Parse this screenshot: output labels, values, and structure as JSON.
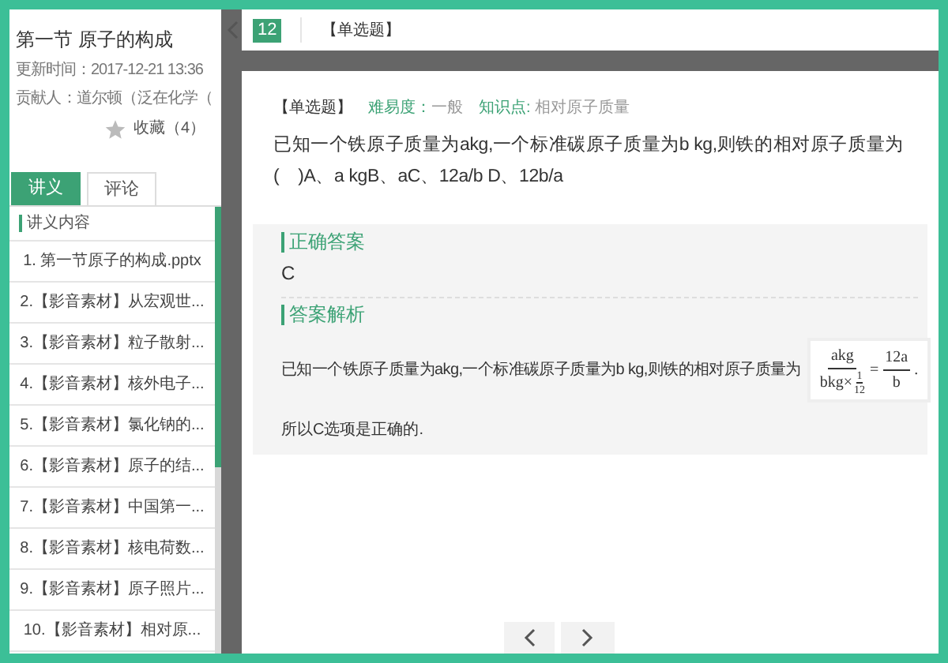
{
  "sidebar": {
    "title": "第一节 原子的构成",
    "updated": "更新时间：2017-12-21 13:36",
    "contributor": "贡献人：道尔顿（泛在化学（",
    "favorite": {
      "label": "收藏（4）",
      "selected": false
    },
    "tabs": [
      {
        "label": "讲义",
        "selected": true
      },
      {
        "label": "评论",
        "selected": false
      }
    ],
    "list_heading": "讲义内容",
    "items": [
      {
        "label": "1. 第一节原子的构成.pptx"
      },
      {
        "label": "2.【影音素材】从宏观世..."
      },
      {
        "label": "3.【影音素材】粒子散射..."
      },
      {
        "label": "4.【影音素材】核外电子..."
      },
      {
        "label": "5.【影音素材】氯化钠的..."
      },
      {
        "label": "6.【影音素材】原子的结..."
      },
      {
        "label": "7.【影音素材】中国第一..."
      },
      {
        "label": "8.【影音素材】核电荷数..."
      },
      {
        "label": "9.【影音素材】原子照片..."
      },
      {
        "label": "10.【影音素材】相对原..."
      }
    ]
  },
  "header": {
    "number": "12",
    "type": "【单选题】"
  },
  "question": {
    "type": "【单选题】",
    "difficulty_label": "难易度：",
    "difficulty": "一般",
    "knowledge_label": "知识点:",
    "knowledge": "相对原子质量",
    "text": "已知一个铁原子质量为akg,一个标准碳原子质量为b kg,则铁的相对原子质量为(    )A、a kgB、aC、12a/b D、12b/a"
  },
  "answer": {
    "heading": "正确答案",
    "value": "C"
  },
  "analysis": {
    "heading": "答案解析",
    "text": "已知一个铁原子质量为akg,一个标准碳原子质量为b kg,则铁的相对原子质量为",
    "formula": {
      "num1": "akg",
      "den1": "bkg×",
      "sub_num": "1",
      "sub_den": "12",
      "eq": "=",
      "num2": "12a",
      "den2": "b",
      "end": "."
    },
    "conclusion": "所以C选项是正确的."
  }
}
